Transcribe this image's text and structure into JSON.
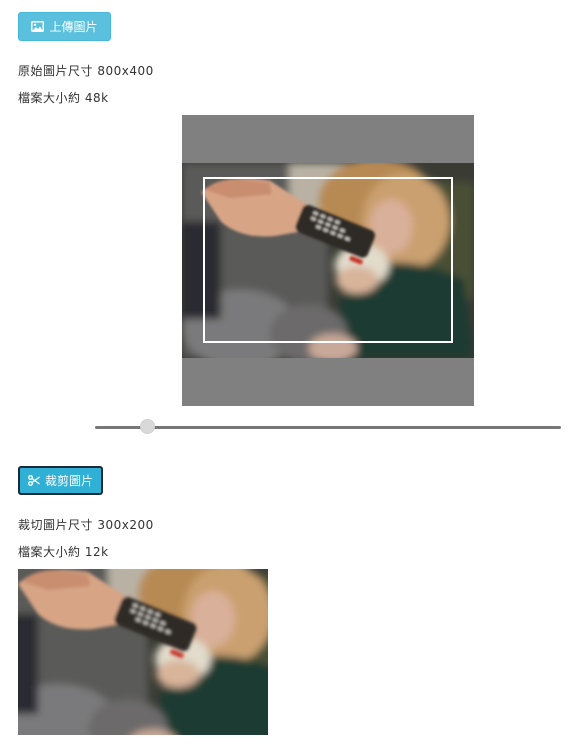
{
  "upload": {
    "label": "上傳圖片",
    "icon": "image-icon"
  },
  "original": {
    "size_text": "原始圖片尺寸 800x400",
    "filesize_text": "檔案大小約 48k"
  },
  "zoom_slider": {
    "value_fraction": 0.1
  },
  "crop": {
    "label": "裁剪圖片",
    "icon": "scissors-icon"
  },
  "cropped": {
    "size_text": "裁切圖片尺寸 300x200",
    "filesize_text": "檔案大小約 12k"
  },
  "colors": {
    "button": "#5bc0de",
    "cropper_background": "#808080"
  }
}
